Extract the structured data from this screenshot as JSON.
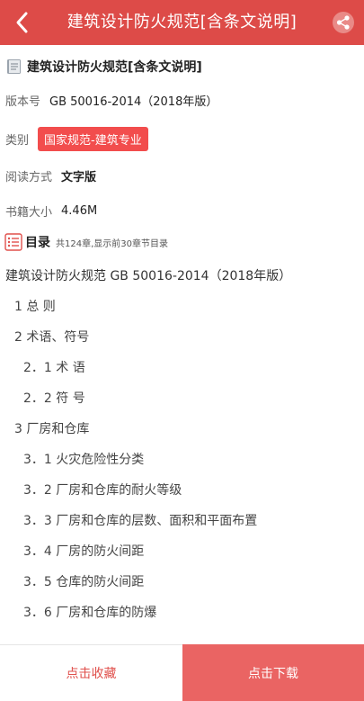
{
  "colors": {
    "header": "#dd4b48",
    "accent": "#f24d4d",
    "download_bg": "#ea6463",
    "collect_text": "#e0504c"
  },
  "header": {
    "title": "建筑设计防火规范[含条文说明]",
    "back_icon": "chevron-left-icon",
    "share_icon": "share-icon"
  },
  "book": {
    "title": "建筑设计防火规范[含条文说明]",
    "icon": "book-icon",
    "version_label": "版本号",
    "version_value": "GB 50016-2014（2018年版）",
    "category_label": "类别",
    "category_value": "国家规范-建筑专业",
    "read_label": "阅读方式",
    "read_value": "文字版",
    "size_label": "书籍大小",
    "size_value": "4.46M"
  },
  "toc": {
    "label": "目录",
    "note": "共124章,显示前30章节目录",
    "icon": "list-icon",
    "items": [
      "建筑设计防火规范 GB 50016-2014（2018年版）",
      "1 总 则",
      "2 术语、符号",
      "2．1 术 语",
      "2．2 符 号",
      "3 厂房和仓库",
      "3．1 火灾危险性分类",
      "3．2 厂房和仓库的耐火等级",
      "3．3 厂房和仓库的层数、面积和平面布置",
      "3．4 厂房的防火间距",
      "3．5 仓库的防火间距",
      "3．6 厂房和仓库的防爆"
    ]
  },
  "footer": {
    "collect_label": "点击收藏",
    "download_label": "点击下载"
  }
}
